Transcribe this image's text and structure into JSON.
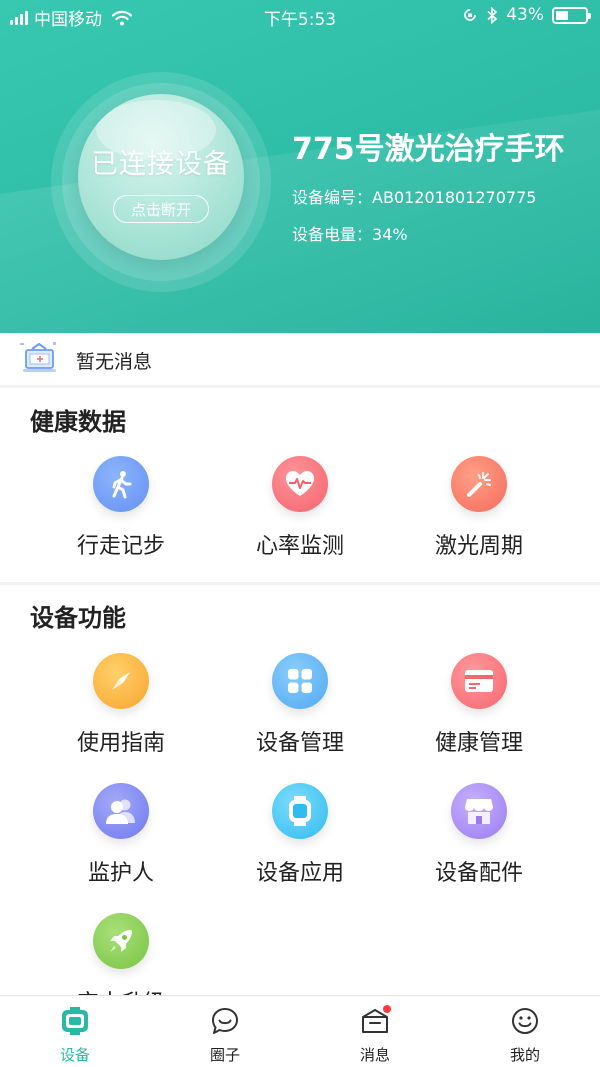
{
  "status_bar": {
    "carrier": "中国移动",
    "time": "下午5:53",
    "battery": "43%",
    "battery_level": 0.43
  },
  "device_card": {
    "status": "已连接设备",
    "disconnect_label": "点击断开",
    "name": "775号激光治疗手环",
    "serial_label": "设备编号：",
    "serial_value": "AB01201801270775",
    "power_label": "设备电量：",
    "power_value": "34%"
  },
  "notice": {
    "text": "暂无消息"
  },
  "health_section": {
    "title": "健康数据",
    "items": [
      {
        "label": "行走记步",
        "icon": "walk-icon",
        "color": "#6c9cf7"
      },
      {
        "label": "心率监测",
        "icon": "heart-rate-icon",
        "color": "#fb6d74"
      },
      {
        "label": "激光周期",
        "icon": "laser-icon",
        "color": "#fb7563"
      }
    ]
  },
  "device_section": {
    "title": "设备功能",
    "items": [
      {
        "label": "使用指南",
        "icon": "compass-icon",
        "color": "#f9b33a"
      },
      {
        "label": "设备管理",
        "icon": "grid-icon",
        "color": "#5ab3f6"
      },
      {
        "label": "健康管理",
        "icon": "card-icon",
        "color": "#fb6e73"
      },
      {
        "label": "监护人",
        "icon": "guardian-icon",
        "color": "#7c87f1"
      },
      {
        "label": "设备应用",
        "icon": "watch-icon",
        "color": "#3ec2f3"
      },
      {
        "label": "设备配件",
        "icon": "store-icon",
        "color": "#a48af4"
      },
      {
        "label": "空中升级",
        "icon": "rocket-icon",
        "color": "#83cc4b"
      }
    ]
  },
  "tabbar": {
    "tabs": [
      {
        "label": "设备",
        "icon": "device-icon",
        "active": true
      },
      {
        "label": "圈子",
        "icon": "chat-icon",
        "active": false
      },
      {
        "label": "消息",
        "icon": "inbox-icon",
        "active": false,
        "badge": true
      },
      {
        "label": "我的",
        "icon": "smile-icon",
        "active": false
      }
    ],
    "active_color": "#2bb8a7"
  }
}
